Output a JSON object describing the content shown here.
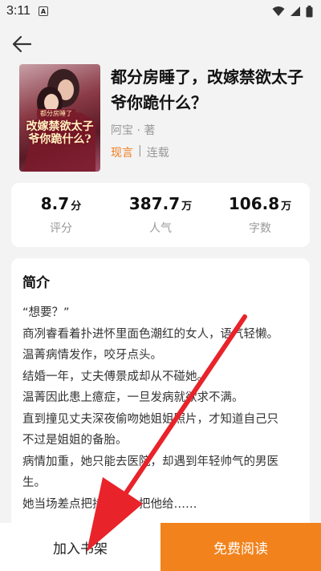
{
  "status_bar": {
    "time": "3:11",
    "notif_glyph": "A"
  },
  "book": {
    "cover_tag": "都分房睡了",
    "cover_title": "改嫁禁欲太子爷你跪什么?",
    "title": "都分房睡了，改嫁禁欲太子爷你跪什么？",
    "author": "阿宝 · 著",
    "genre": "现言",
    "separator": "|",
    "status": "连载"
  },
  "stats": [
    {
      "value": "8.7",
      "unit": "分",
      "label": "评分"
    },
    {
      "value": "387.7",
      "unit": "万",
      "label": "人气"
    },
    {
      "value": "106.8",
      "unit": "万",
      "label": "字数"
    }
  ],
  "intro": {
    "heading": "简介",
    "lines": [
      "“想要？”",
      "商冽睿看着扑进怀里面色潮红的女人，语气轻懒。",
      "温菁病情发作，咬牙点头。",
      "结婚一年，丈夫傅景成却从不碰她。",
      "温菁因此患上癔症，一旦发病就欲求不满。",
      "直到撞见丈夫深夜偷吻她姐姐照片，才知道自己只",
      "不过是姐姐的备胎。",
      "病情加重，她只能去医院，却遇到年轻帅气的男医",
      "生。",
      "她当场差点把持不住，把他给……"
    ]
  },
  "bottom": {
    "add_label": "加入书架",
    "read_label": "免费阅读"
  },
  "colors": {
    "accent": "#f2821c",
    "arrow": "#e8232a"
  }
}
